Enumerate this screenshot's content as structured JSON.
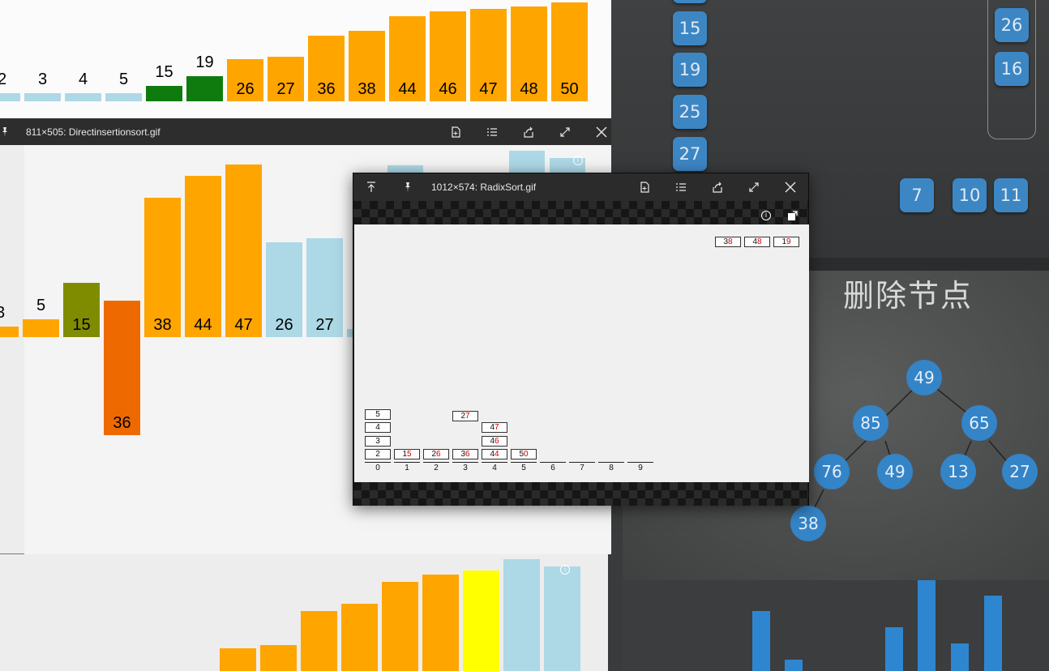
{
  "top_window": {
    "bars": [
      {
        "label": "2",
        "color": "#add8e6"
      },
      {
        "label": "3",
        "color": "#add8e6"
      },
      {
        "label": "4",
        "color": "#add8e6"
      },
      {
        "label": "5",
        "color": "#add8e6"
      },
      {
        "label": "15",
        "color": "#0f7b0f"
      },
      {
        "label": "19",
        "color": "#0f7b0f"
      },
      {
        "label": "26",
        "color": "#ffa500"
      },
      {
        "label": "27",
        "color": "#ffa500"
      },
      {
        "label": "36",
        "color": "#ffa500"
      },
      {
        "label": "38",
        "color": "#ffa500"
      },
      {
        "label": "44",
        "color": "#ffa500"
      },
      {
        "label": "46",
        "color": "#ffa500"
      },
      {
        "label": "47",
        "color": "#ffa500"
      },
      {
        "label": "48",
        "color": "#ffa500"
      },
      {
        "label": "50",
        "color": "#ffa500"
      }
    ]
  },
  "middle_window": {
    "title": "811×505: Directinsertionsort.gif",
    "bars": [
      {
        "label": "3",
        "color": "#ffa500"
      },
      {
        "label": "5",
        "color": "#ffa500"
      },
      {
        "label": "15",
        "color": "#808c00"
      },
      {
        "label": "36",
        "color": "#ee6a00"
      },
      {
        "label": "38",
        "color": "#ffa500"
      },
      {
        "label": "44",
        "color": "#ffa500"
      },
      {
        "label": "47",
        "color": "#ffa500"
      },
      {
        "label": "26",
        "color": "#add8e6"
      },
      {
        "label": "27",
        "color": "#add8e6"
      }
    ]
  },
  "bottom_window": {
    "bar_colors": [
      "#ffa500",
      "#ffa500",
      "#ffa500",
      "#ffa500",
      "#ffa500",
      "#ffa500",
      "#ffff00",
      "#add8e6",
      "#add8e6"
    ]
  },
  "radix_window": {
    "title": "1012×574: RadixSort.gif",
    "pending": [
      {
        "tens": "3",
        "ones": "8"
      },
      {
        "tens": "4",
        "ones": "8"
      },
      {
        "tens": "1",
        "ones": "9"
      }
    ],
    "bucket_indices": [
      "0",
      "1",
      "2",
      "3",
      "4",
      "5",
      "6",
      "7",
      "8",
      "9"
    ],
    "buckets": [
      [
        {
          "tens": "",
          "ones": "2"
        },
        {
          "tens": "",
          "ones": "3"
        },
        {
          "tens": "",
          "ones": "4"
        },
        {
          "tens": "",
          "ones": "5"
        }
      ],
      [
        {
          "tens": "1",
          "ones": "5"
        }
      ],
      [
        {
          "tens": "2",
          "ones": "6"
        }
      ],
      [
        {
          "tens": "3",
          "ones": "6"
        },
        {
          "tens": "2",
          "ones": "7"
        }
      ],
      [
        {
          "tens": "4",
          "ones": "4"
        },
        {
          "tens": "4",
          "ones": "6"
        },
        {
          "tens": "4",
          "ones": "7"
        }
      ],
      [
        {
          "tens": "5",
          "ones": "0"
        }
      ],
      [],
      [],
      [],
      []
    ]
  },
  "right_top_window": {
    "left_column": [
      "15",
      "19",
      "25",
      "27"
    ],
    "right_column": [
      "26",
      "16"
    ],
    "bottom_row": [
      "7",
      "10",
      "11"
    ]
  },
  "tree_window": {
    "title": "删除节点",
    "nodes": [
      "49",
      "85",
      "65",
      "76",
      "49",
      "13",
      "27",
      "38"
    ]
  },
  "icons": {
    "pin": "pin-icon",
    "new_doc": "new-document-icon",
    "list": "list-icon",
    "share": "share-icon",
    "expand": "expand-icon",
    "close": "close-icon",
    "top": "move-to-top-icon",
    "info": "info-icon",
    "export": "export-icon"
  }
}
